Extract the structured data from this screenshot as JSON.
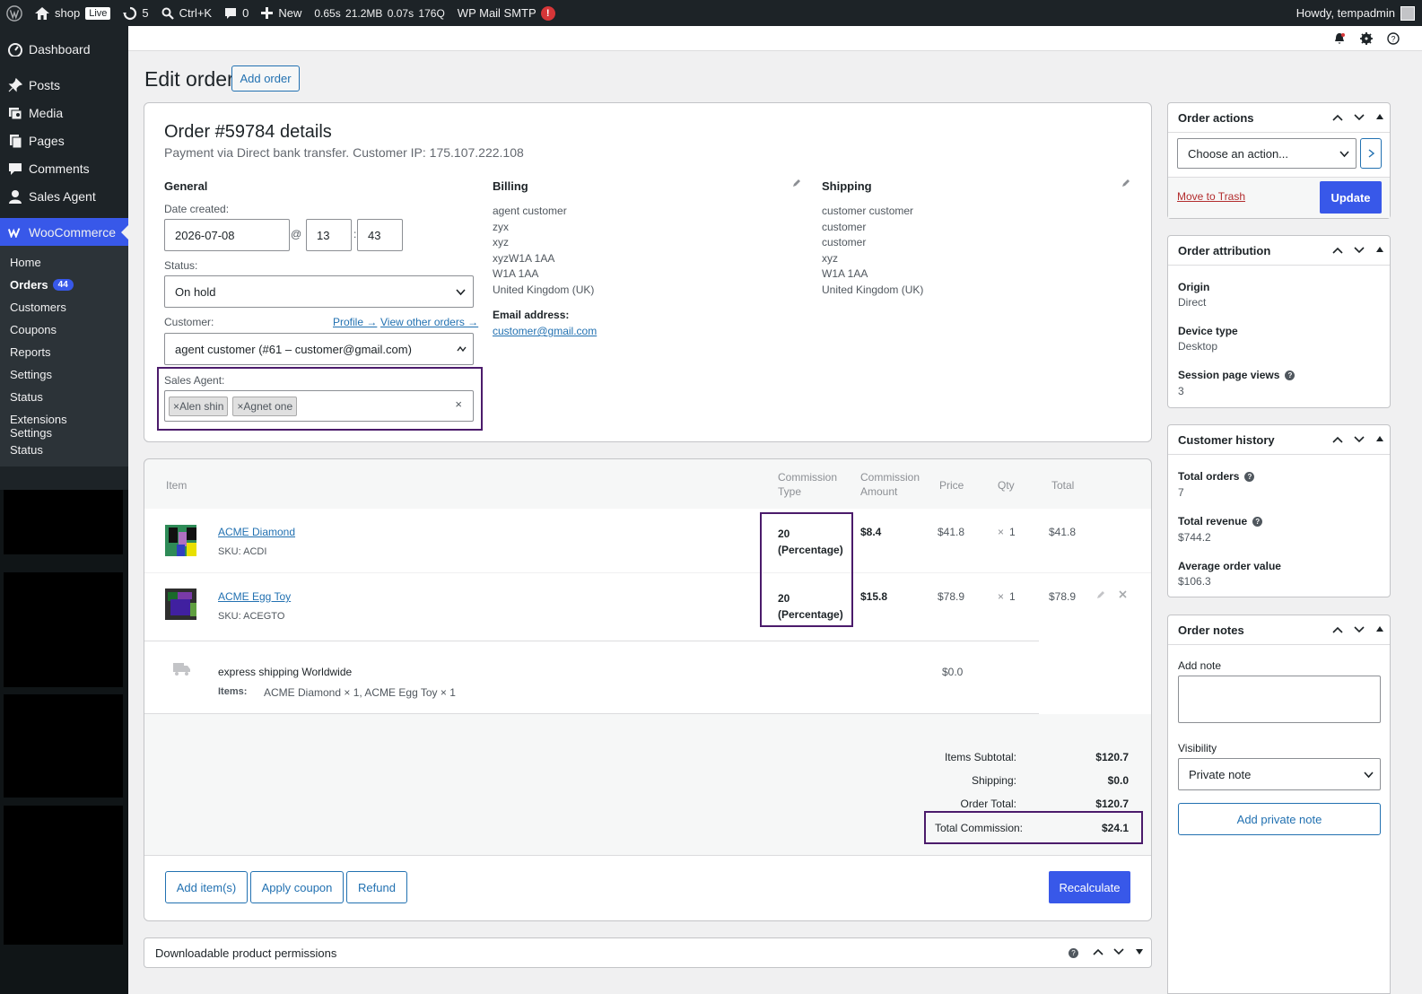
{
  "adminbar": {
    "site": "shop",
    "live": "Live",
    "updates": "5",
    "search": "Ctrl+K",
    "comments": "0",
    "new": "New",
    "perf": "0.65s  21.2MB  0.07s  176Q",
    "smtp": "WP Mail SMTP",
    "smtp_badge": "!",
    "howdy": "Howdy, tempadmin"
  },
  "sidebar": {
    "items": [
      {
        "label": "Dashboard",
        "icon": "dashboard-icon"
      },
      {
        "label": "Posts",
        "icon": "pin-icon"
      },
      {
        "label": "Media",
        "icon": "media-icon"
      },
      {
        "label": "Pages",
        "icon": "pages-icon"
      },
      {
        "label": "Comments",
        "icon": "comment-icon"
      },
      {
        "label": "Sales Agent",
        "icon": "user-icon"
      },
      {
        "label": "WooCommerce",
        "icon": "woo-icon"
      }
    ],
    "submenu": [
      {
        "label": "Home"
      },
      {
        "label": "Orders",
        "count": "44"
      },
      {
        "label": "Customers"
      },
      {
        "label": "Coupons"
      },
      {
        "label": "Reports"
      },
      {
        "label": "Settings"
      },
      {
        "label": "Status"
      },
      {
        "label": "Extensions"
      },
      {
        "label": "Settings"
      },
      {
        "label": "Status"
      }
    ]
  },
  "page": {
    "title": "Edit order",
    "add_order": "Add order"
  },
  "order": {
    "heading": "Order #59784 details",
    "payment": "Payment via Direct bank transfer. Customer IP: 175.107.222.108",
    "general": "General",
    "date_label": "Date created:",
    "date": "2026-07-08",
    "at": "@",
    "hour": "13",
    "colon": ":",
    "minute": "43",
    "status_label": "Status:",
    "status": "On hold",
    "customer_label": "Customer:",
    "profile_link": "Profile →",
    "view_orders_link": "View other orders →",
    "customer": "agent customer (#61 – customer@gmail.com)",
    "sales_agent_label": "Sales Agent:",
    "agents": [
      "Alen shin",
      "Agnet one"
    ],
    "tag_remove": "×",
    "clear": "×",
    "billing_title": "Billing",
    "billing": [
      "agent customer",
      "zyx",
      "xyz",
      "xyzW1A 1AA",
      "W1A 1AA",
      "United Kingdom (UK)"
    ],
    "email_label": "Email address:",
    "email": "customer@gmail.com",
    "shipping_title": "Shipping",
    "shipping": [
      "customer customer",
      "customer",
      "customer",
      "xyz",
      "W1A 1AA",
      "United Kingdom (UK)"
    ]
  },
  "items": {
    "headers": {
      "item": "Item",
      "ctype": "Commission Type",
      "camount": "Commission Amount",
      "price": "Price",
      "qty": "Qty",
      "total": "Total"
    },
    "rows": [
      {
        "name": "ACME Diamond",
        "sku": "SKU: ACDI",
        "ctype": "20 (Percentage)",
        "camount": "$8.4",
        "price": "$41.8",
        "times": "×",
        "qty": "1",
        "total": "$41.8"
      },
      {
        "name": "ACME Egg Toy",
        "sku": "SKU: ACEGTO",
        "ctype": "20 (Percentage)",
        "camount": "$15.8",
        "price": "$78.9",
        "times": "×",
        "qty": "1",
        "total": "$78.9"
      }
    ],
    "shipping": {
      "name": "express shipping Worldwide",
      "items_label": "Items:",
      "items": "ACME Diamond × 1, ACME Egg Toy × 1",
      "cost": "$0.0"
    },
    "totals": {
      "subtotal_label": "Items Subtotal:",
      "subtotal": "$120.7",
      "shipping_label": "Shipping:",
      "shipping": "$0.0",
      "order_total_label": "Order Total:",
      "order_total": "$120.7",
      "commission_label": "Total Commission:",
      "commission": "$24.1"
    },
    "buttons": {
      "add_items": "Add item(s)",
      "apply_coupon": "Apply coupon",
      "refund": "Refund",
      "recalculate": "Recalculate"
    }
  },
  "downloadable": {
    "title": "Downloadable product permissions"
  },
  "order_actions": {
    "title": "Order actions",
    "select": "Choose an action...",
    "trash": "Move to Trash",
    "update": "Update"
  },
  "attribution": {
    "title": "Order attribution",
    "origin_label": "Origin",
    "origin": "Direct",
    "device_label": "Device type",
    "device": "Desktop",
    "views_label": "Session page views",
    "views": "3"
  },
  "history": {
    "title": "Customer history",
    "total_orders_label": "Total orders",
    "total_orders": "7",
    "revenue_label": "Total revenue",
    "revenue": "$744.2",
    "aov_label": "Average order value",
    "aov": "$106.3"
  },
  "notes": {
    "title": "Order notes",
    "add_note_label": "Add note",
    "visibility_label": "Visibility",
    "visibility": "Private note",
    "add_button": "Add private note"
  }
}
